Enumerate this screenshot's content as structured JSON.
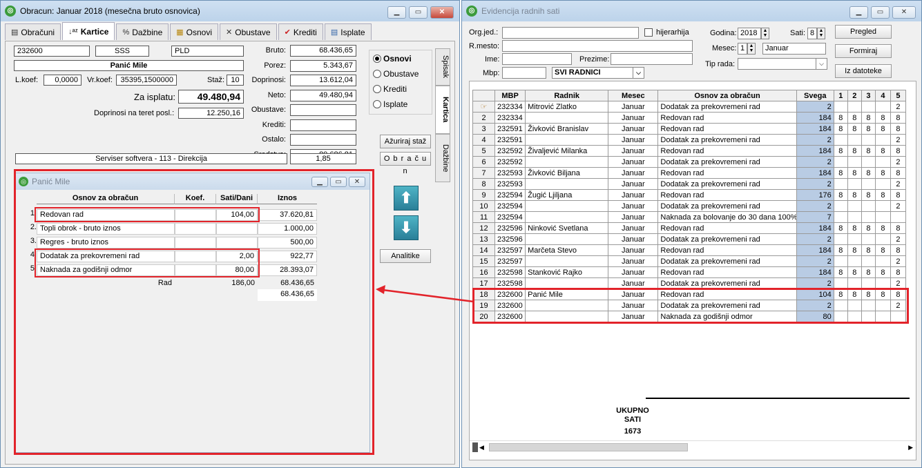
{
  "left": {
    "title": "Obracun: Januar 2018 (mesečna bruto osnovica)",
    "tabs": [
      {
        "label": "Obračuni",
        "icon": "list-icon"
      },
      {
        "label": "Kartice",
        "icon": "sort-az-icon"
      },
      {
        "label": "Dažbine",
        "icon": "percent-icon"
      },
      {
        "label": "Osnovi",
        "icon": "chart-icon"
      },
      {
        "label": "Obustave",
        "icon": "x-icon"
      },
      {
        "label": "Krediti",
        "icon": "check-icon"
      },
      {
        "label": "Isplate",
        "icon": "document-icon"
      }
    ],
    "code": "232600",
    "sss": "SSS",
    "pld": "PLD",
    "name": "Panić Mile",
    "lkoef_label": "L.koef:",
    "lkoef": "0,0000",
    "vrkoef_label": "Vr.koef:",
    "vrkoef": "35395,1500000",
    "staz_label": "Staž:",
    "staz": "10",
    "za_isplatu_label": "Za isplatu:",
    "za_isplatu": "49.480,94",
    "doprinosi_posl_label": "Doprinosi na teret posl.:",
    "doprinosi_posl": "12.250,16",
    "summary": [
      {
        "label": "Bruto:",
        "value": "68.436,65"
      },
      {
        "label": "Porez:",
        "value": "5.343,67"
      },
      {
        "label": "Doprinosi:",
        "value": "13.612,04"
      },
      {
        "label": "Neto:",
        "value": "49.480,94"
      },
      {
        "label": "Obustave:",
        "value": ""
      },
      {
        "label": "Krediti:",
        "value": ""
      },
      {
        "label": "Ostalo:",
        "value": ""
      },
      {
        "label": "Sredstva:",
        "value": "80.686,81"
      }
    ],
    "position": "Serviser softvera - 113 - Direkcija",
    "coef_value": "1,85",
    "radios": [
      "Osnovi",
      "Obustave",
      "Krediti",
      "Isplate"
    ],
    "vtabs": [
      "Spisak",
      "Kartica",
      "Dažbine"
    ],
    "azuriraj": "Ažuriraj staž",
    "obracun": "O b r a č u n",
    "analitike": "Analitike"
  },
  "sub": {
    "title": "Panić Mile",
    "headers": [
      "Osnov za obračun",
      "Koef.",
      "Sati/Dani",
      "Iznos"
    ],
    "rows": [
      {
        "n": "1.",
        "osnov": "Redovan rad",
        "koef": "",
        "sati": "104,00",
        "iznos": "37.620,81"
      },
      {
        "n": "2.",
        "osnov": "Topli obrok - bruto iznos",
        "koef": "",
        "sati": "",
        "iznos": "1.000,00"
      },
      {
        "n": "3.",
        "osnov": "Regres - bruto iznos",
        "koef": "",
        "sati": "",
        "iznos": "500,00"
      },
      {
        "n": "4.",
        "osnov": "Dodatak za prekovremeni rad",
        "koef": "",
        "sati": "2,00",
        "iznos": "922,77"
      },
      {
        "n": "5.",
        "osnov": "Naknada za godišnji odmor",
        "koef": "",
        "sati": "80,00",
        "iznos": "28.393,07"
      }
    ],
    "rad_label": "Rad",
    "rad_sati": "186,00",
    "rad_iznos": "68.436,65",
    "total": "68.436,65"
  },
  "right": {
    "title": "Evidencija radnih sati",
    "filters": {
      "orgjed_label": "Org.jed.:",
      "hijerarhija": "hijerarhija",
      "godina_label": "Godina:",
      "godina": "2018",
      "sati_label": "Sati:",
      "sati": "8",
      "rmesto_label": "R.mesto:",
      "mesec_label": "Mesec:",
      "mesec_num": "1",
      "mesec_name": "Januar",
      "ime_label": "Ime:",
      "prezime_label": "Prezime:",
      "tiprada_label": "Tip rada:",
      "mbp_label": "Mbp:",
      "svi": "SVI RADNICI"
    },
    "buttons": [
      "Pregled",
      "Formiraj",
      "Iz datoteke"
    ],
    "headers": [
      "MBP",
      "Radnik",
      "Mesec",
      "Osnov za obračun",
      "Svega",
      "1",
      "2",
      "3",
      "4",
      "5"
    ],
    "rows": [
      {
        "n": "",
        "mbp": "232334",
        "radnik": "Mitrović  Zlatko",
        "mesec": "Januar",
        "osnov": "Dodatak za prekovremeni rad",
        "svega": "2",
        "d": [
          "",
          "",
          "",
          "",
          "2"
        ]
      },
      {
        "n": "2",
        "mbp": "232334",
        "radnik": "",
        "mesec": "Januar",
        "osnov": "Redovan rad",
        "svega": "184",
        "d": [
          "8",
          "8",
          "8",
          "8",
          "8"
        ]
      },
      {
        "n": "3",
        "mbp": "232591",
        "radnik": "Živković  Branislav",
        "mesec": "Januar",
        "osnov": "Redovan rad",
        "svega": "184",
        "d": [
          "8",
          "8",
          "8",
          "8",
          "8"
        ]
      },
      {
        "n": "4",
        "mbp": "232591",
        "radnik": "",
        "mesec": "Januar",
        "osnov": "Dodatak za prekovremeni rad",
        "svega": "2",
        "d": [
          "",
          "",
          "",
          "",
          "2"
        ]
      },
      {
        "n": "5",
        "mbp": "232592",
        "radnik": "Živaljević  Milanka",
        "mesec": "Januar",
        "osnov": "Redovan rad",
        "svega": "184",
        "d": [
          "8",
          "8",
          "8",
          "8",
          "8"
        ]
      },
      {
        "n": "6",
        "mbp": "232592",
        "radnik": "",
        "mesec": "Januar",
        "osnov": "Dodatak za prekovremeni rad",
        "svega": "2",
        "d": [
          "",
          "",
          "",
          "",
          "2"
        ]
      },
      {
        "n": "7",
        "mbp": "232593",
        "radnik": "Živković  Biljana",
        "mesec": "Januar",
        "osnov": "Redovan rad",
        "svega": "184",
        "d": [
          "8",
          "8",
          "8",
          "8",
          "8"
        ]
      },
      {
        "n": "8",
        "mbp": "232593",
        "radnik": "",
        "mesec": "Januar",
        "osnov": "Dodatak za prekovremeni rad",
        "svega": "2",
        "d": [
          "",
          "",
          "",
          "",
          "2"
        ]
      },
      {
        "n": "9",
        "mbp": "232594",
        "radnik": "Žugić  Ljiljana",
        "mesec": "Januar",
        "osnov": "Redovan rad",
        "svega": "176",
        "d": [
          "8",
          "8",
          "8",
          "8",
          "8"
        ]
      },
      {
        "n": "10",
        "mbp": "232594",
        "radnik": "",
        "mesec": "Januar",
        "osnov": "Dodatak za prekovremeni rad",
        "svega": "2",
        "d": [
          "",
          "",
          "",
          "",
          "2"
        ]
      },
      {
        "n": "11",
        "mbp": "232594",
        "radnik": "",
        "mesec": "Januar",
        "osnov": "Naknada za bolovanje do 30 dana 100%",
        "svega": "7",
        "d": [
          "",
          "",
          "",
          "",
          ""
        ]
      },
      {
        "n": "12",
        "mbp": "232596",
        "radnik": "Ninković  Svetlana",
        "mesec": "Januar",
        "osnov": "Redovan rad",
        "svega": "184",
        "d": [
          "8",
          "8",
          "8",
          "8",
          "8"
        ]
      },
      {
        "n": "13",
        "mbp": "232596",
        "radnik": "",
        "mesec": "Januar",
        "osnov": "Dodatak za prekovremeni rad",
        "svega": "2",
        "d": [
          "",
          "",
          "",
          "",
          "2"
        ]
      },
      {
        "n": "14",
        "mbp": "232597",
        "radnik": "Marčeta  Stevo",
        "mesec": "Januar",
        "osnov": "Redovan rad",
        "svega": "184",
        "d": [
          "8",
          "8",
          "8",
          "8",
          "8"
        ]
      },
      {
        "n": "15",
        "mbp": "232597",
        "radnik": "",
        "mesec": "Januar",
        "osnov": "Dodatak za prekovremeni rad",
        "svega": "2",
        "d": [
          "",
          "",
          "",
          "",
          "2"
        ]
      },
      {
        "n": "16",
        "mbp": "232598",
        "radnik": "Stanković  Rajko",
        "mesec": "Januar",
        "osnov": "Redovan rad",
        "svega": "184",
        "d": [
          "8",
          "8",
          "8",
          "8",
          "8"
        ]
      },
      {
        "n": "17",
        "mbp": "232598",
        "radnik": "",
        "mesec": "Januar",
        "osnov": "Dodatak za prekovremeni rad",
        "svega": "2",
        "d": [
          "",
          "",
          "",
          "",
          "2"
        ]
      },
      {
        "n": "18",
        "mbp": "232600",
        "radnik": "Panić  Mile",
        "mesec": "Januar",
        "osnov": "Redovan rad",
        "svega": "104",
        "d": [
          "8",
          "8",
          "8",
          "8",
          "8"
        ]
      },
      {
        "n": "19",
        "mbp": "232600",
        "radnik": "",
        "mesec": "Januar",
        "osnov": "Dodatak za prekovremeni rad",
        "svega": "2",
        "d": [
          "",
          "",
          "",
          "",
          "2"
        ]
      },
      {
        "n": "20",
        "mbp": "232600",
        "radnik": "",
        "mesec": "Januar",
        "osnov": "Naknada za godišnji odmor",
        "svega": "80",
        "d": [
          "",
          "",
          "",
          "",
          ""
        ]
      }
    ],
    "ukupno_line1": "UKUPNO",
    "ukupno_line2": "SATI",
    "ukupno_value": "1673"
  },
  "colors": {
    "highlight": "#e2232a",
    "svega": "#b9cce4",
    "arrow": "#2a7f98"
  }
}
